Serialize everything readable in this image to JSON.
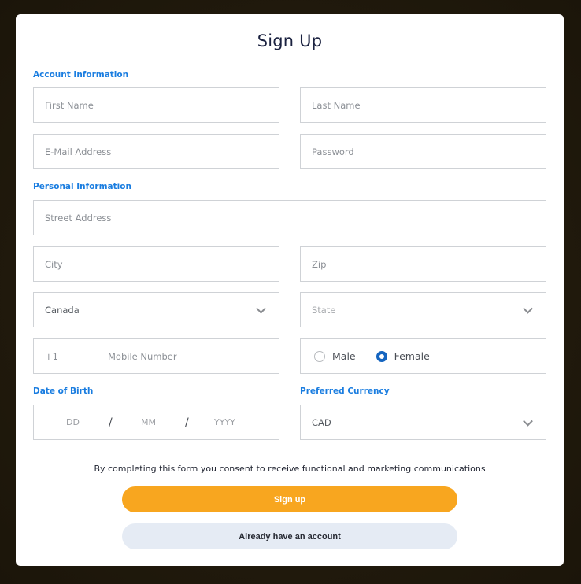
{
  "title": "Sign Up",
  "sections": {
    "account": "Account Information",
    "personal": "Personal Information",
    "dob": "Date of Birth",
    "currency": "Preferred Currency"
  },
  "fields": {
    "first_name": {
      "placeholder": "First Name"
    },
    "last_name": {
      "placeholder": "Last Name"
    },
    "email": {
      "placeholder": "E-Mail Address"
    },
    "password": {
      "placeholder": "Password"
    },
    "street": {
      "placeholder": "Street Address"
    },
    "city": {
      "placeholder": "City"
    },
    "zip": {
      "placeholder": "Zip"
    },
    "country": {
      "value": "Canada"
    },
    "state": {
      "placeholder": "State"
    },
    "phone_prefix": "+1",
    "mobile": {
      "placeholder": "Mobile Number"
    },
    "gender": {
      "options": [
        "Male",
        "Female"
      ],
      "selected": "Female"
    },
    "dob": {
      "day": "DD",
      "month": "MM",
      "year": "YYYY",
      "separator": "/"
    },
    "currency": {
      "value": "CAD"
    }
  },
  "consent_text": "By completing this form you consent to receive functional and marketing communications",
  "buttons": {
    "signup": "Sign up",
    "have_account": "Already have an account"
  },
  "colors": {
    "accent": "#1a7de0",
    "primary_button": "#f8a61f",
    "secondary_button": "#e5ebf4",
    "radio_selected": "#1565c0"
  }
}
